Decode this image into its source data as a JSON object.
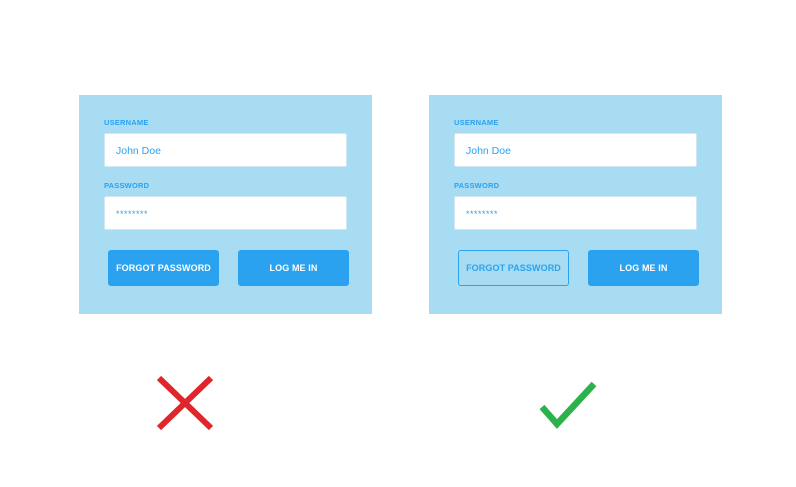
{
  "bad_example": {
    "username_label": "USERNAME",
    "username_value": "John Doe",
    "password_label": "PASSWORD",
    "password_value": "********",
    "forgot_label": "FORGOT PASSWORD",
    "login_label": "LOG ME IN",
    "verdict_icon": "cross-icon"
  },
  "good_example": {
    "username_label": "USERNAME",
    "username_value": "John Doe",
    "password_label": "PASSWORD",
    "password_value": "********",
    "forgot_label": "FORGOT PASSWORD",
    "login_label": "LOG ME IN",
    "verdict_icon": "check-icon"
  },
  "colors": {
    "panel_bg": "#a7dcf3",
    "accent": "#2aa2f0",
    "cross": "#e0262a",
    "check": "#2db14a"
  }
}
